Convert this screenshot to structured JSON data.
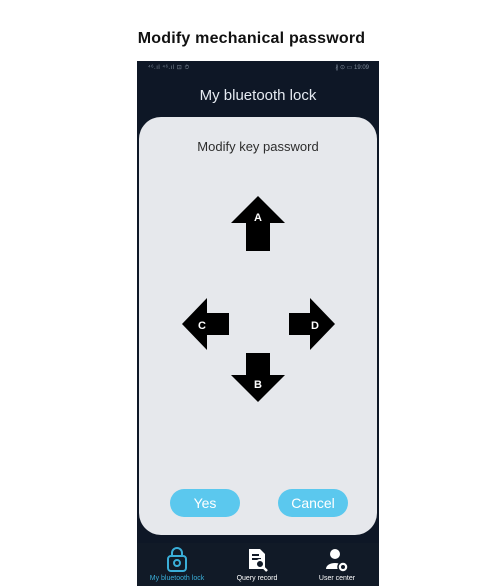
{
  "page": {
    "title": "Modify mechanical password"
  },
  "statusbar": {
    "left": "⁴⁶.ıl ⁴⁶.ıl ⊡ ⏱",
    "right": "∦ ⊙ ▭ 19:09"
  },
  "app": {
    "title": "My bluetooth lock"
  },
  "dialog": {
    "title": "Modify key password",
    "keys": {
      "up": "A",
      "down": "B",
      "left": "C",
      "right": "D"
    },
    "yes_label": "Yes",
    "cancel_label": "Cancel"
  },
  "tabs": [
    {
      "label": "My bluetooth lock",
      "icon": "lock-icon",
      "active": true
    },
    {
      "label": "Query record",
      "icon": "document-search-icon",
      "active": false
    },
    {
      "label": "User center",
      "icon": "user-settings-icon",
      "active": false
    }
  ],
  "colors": {
    "accent": "#5bc8ee",
    "active_tab": "#3aaed8",
    "phone_bg": "#0e1726",
    "dialog_bg": "#e6e8ec"
  }
}
